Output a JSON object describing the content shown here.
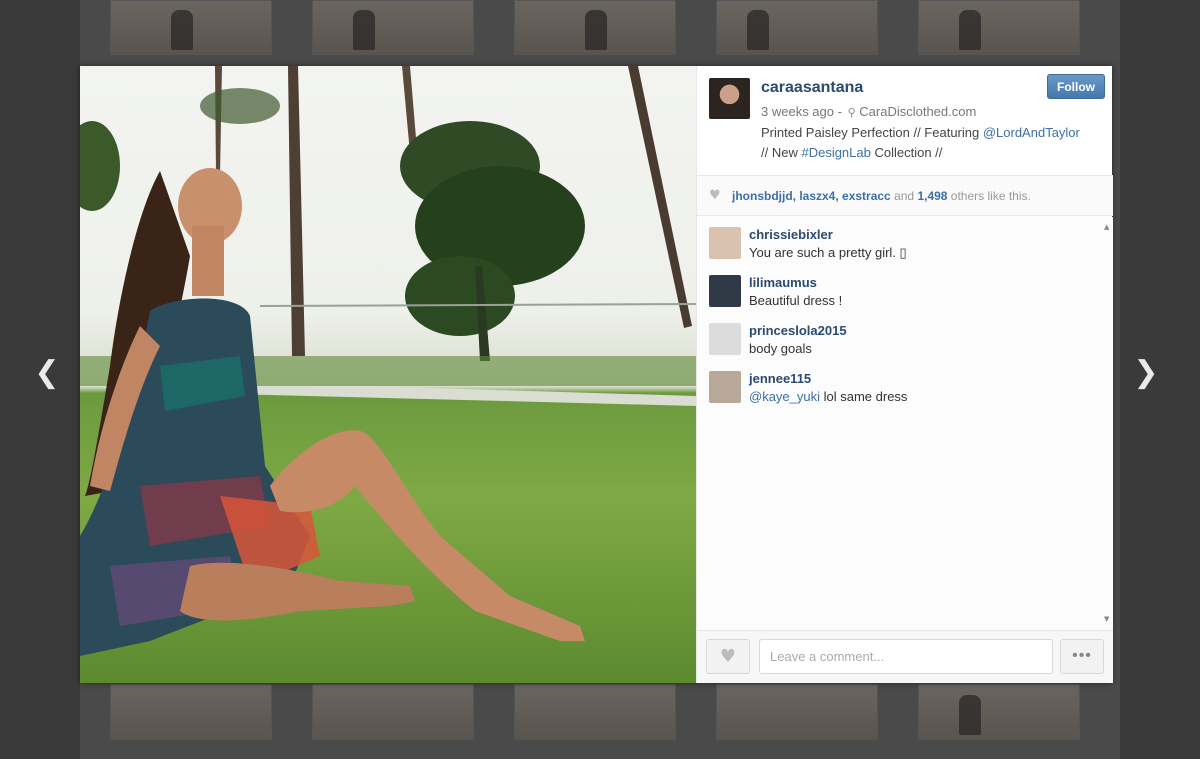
{
  "post": {
    "username": "caraasantana",
    "time": "3 weeks ago",
    "location": "CaraDisclothed.com",
    "follow_label": "Follow",
    "caption_prefix": "Printed Paisley Perfection // Featuring ",
    "caption_mention": "@LordAndTaylor",
    "caption_mid": "// New ",
    "caption_hashtag": "#DesignLab",
    "caption_suffix": " Collection //"
  },
  "likes": {
    "users": "jhonsbdjjd, laszx4, exstracc",
    "and_text": " and ",
    "count": "1,498",
    "suffix": " others like this."
  },
  "comments": [
    {
      "user": "chrissiebixler",
      "text": "You are such a pretty girl. ▯",
      "avatar_color": "#d9c2b0"
    },
    {
      "user": "lilimaumus",
      "text": "Beautiful dress !",
      "avatar_color": "#2f3a46"
    },
    {
      "user": "princeslola2015",
      "text": "body goals",
      "avatar_color": "#dcdcdc"
    },
    {
      "user": "jennee115",
      "mention": "@kaye_yuki",
      "text": " lol same dress",
      "avatar_color": "#b8a89a"
    }
  ],
  "composer": {
    "placeholder": "Leave a comment...",
    "more_label": "•••"
  },
  "icons": {
    "prev": "chevron-left-icon",
    "next": "chevron-right-icon",
    "heart": "heart-icon",
    "location": "location-pin-icon"
  },
  "colors": {
    "link": "#3d6fa8",
    "username": "#2b4a73",
    "follow": "#4678ad"
  }
}
